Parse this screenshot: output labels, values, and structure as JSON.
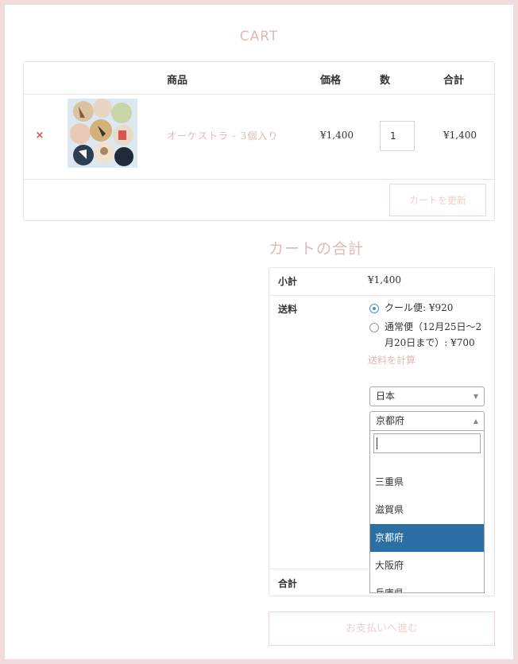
{
  "page_title": "CART",
  "cart_table": {
    "headers": {
      "product": "商品",
      "price": "価格",
      "quantity": "数",
      "total": "合計"
    },
    "row": {
      "remove_symbol": "×",
      "product_name": "オーケストラ - 3個入り",
      "price": "¥1,400",
      "quantity": "1",
      "subtotal": "¥1,400"
    },
    "update_button": "カートを更新"
  },
  "cart_totals": {
    "title": "カートの合計",
    "subtotal_label": "小計",
    "subtotal_value": "¥1,400",
    "shipping_label": "送料",
    "shipping_options": [
      {
        "text": "クール便: ¥920",
        "checked": true
      },
      {
        "line1": "通常便（12月25日〜2",
        "line2": "月20日まで）: ¥700",
        "checked": false
      }
    ],
    "calc_shipping_link": "送料を計算",
    "country_select": "日本",
    "state_select": "京都府",
    "state_options": [
      "三重県",
      "滋賀県",
      "京都府",
      "大阪府",
      "兵庫県"
    ],
    "state_active_index": 2,
    "total_label": "合計"
  },
  "checkout_button": "お支払いへ進む",
  "colors": {
    "accent": "#e0b8b4",
    "highlight": "#2c6fa5",
    "remove": "#d9534f",
    "background": "#f0dcdc"
  }
}
